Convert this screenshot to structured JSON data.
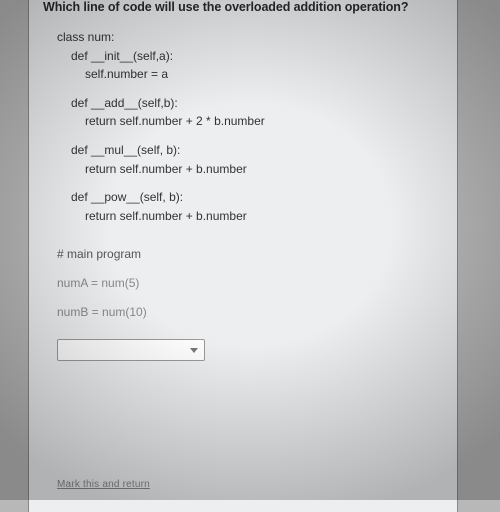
{
  "question": "Which line of code will use the overloaded addition operation?",
  "code": {
    "l1": "class num:",
    "l2": "def __init__(self,a):",
    "l3": "self.number = a",
    "l4": "def __add__(self,b):",
    "l5": "return self.number + 2 * b.number",
    "l6": "def __mul__(self, b):",
    "l7": "return self.number + b.number",
    "l8": "def __pow__(self, b):",
    "l9": "return self.number + b.number",
    "comment": "# main program",
    "l10": "numA = num(5)",
    "l11": "numB = num(10)"
  },
  "select": {
    "icon": "chevron-down"
  },
  "footer": "Mark this and return"
}
